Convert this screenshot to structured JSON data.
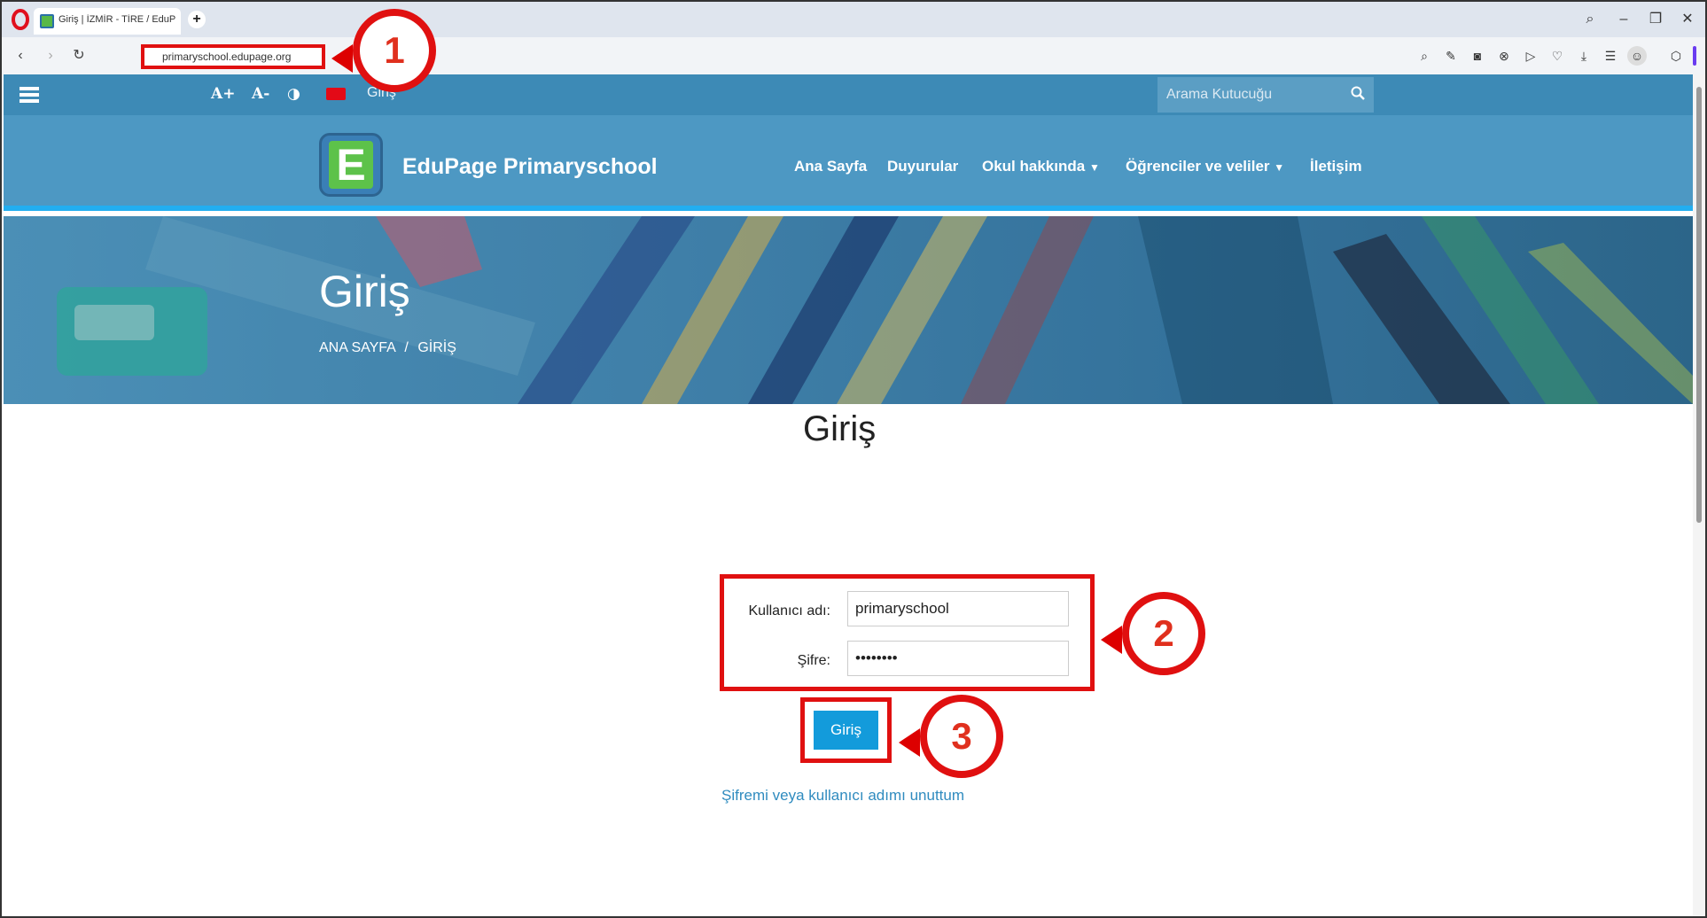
{
  "browser": {
    "tab_title": "Giriş | İZMİR - TİRE / EduP",
    "url": "primaryschool.edupage.org"
  },
  "topbar": {
    "font_increase": "A+",
    "font_decrease": "A-",
    "contrast": "◑",
    "login_link": "Giriş",
    "search_placeholder": "Arama Kutucuğu"
  },
  "header": {
    "site_name": "EduPage Primaryschool",
    "logo_letter": "E",
    "menu": [
      "Ana Sayfa",
      "Duyurular",
      "Okul hakkında",
      "Öğrenciler ve veliler",
      "İletişim"
    ]
  },
  "hero": {
    "title": "Giriş",
    "breadcrumb_home": "ANA SAYFA",
    "breadcrumb_sep": "/",
    "breadcrumb_current": "GİRİŞ"
  },
  "login": {
    "title": "Giriş",
    "username_label": "Kullanıcı adı:",
    "username_value": "primaryschool",
    "password_label": "Şifre:",
    "password_value": "••••••••",
    "submit_label": "Giriş",
    "forgot_link": "Şifremi veya kullanıcı adımı unuttum"
  },
  "callouts": [
    "1",
    "2",
    "3"
  ],
  "colors": {
    "topbar": "#3d8ab6",
    "header": "#4d98c3",
    "accent": "#139bdb",
    "highlight": "#e01010"
  }
}
